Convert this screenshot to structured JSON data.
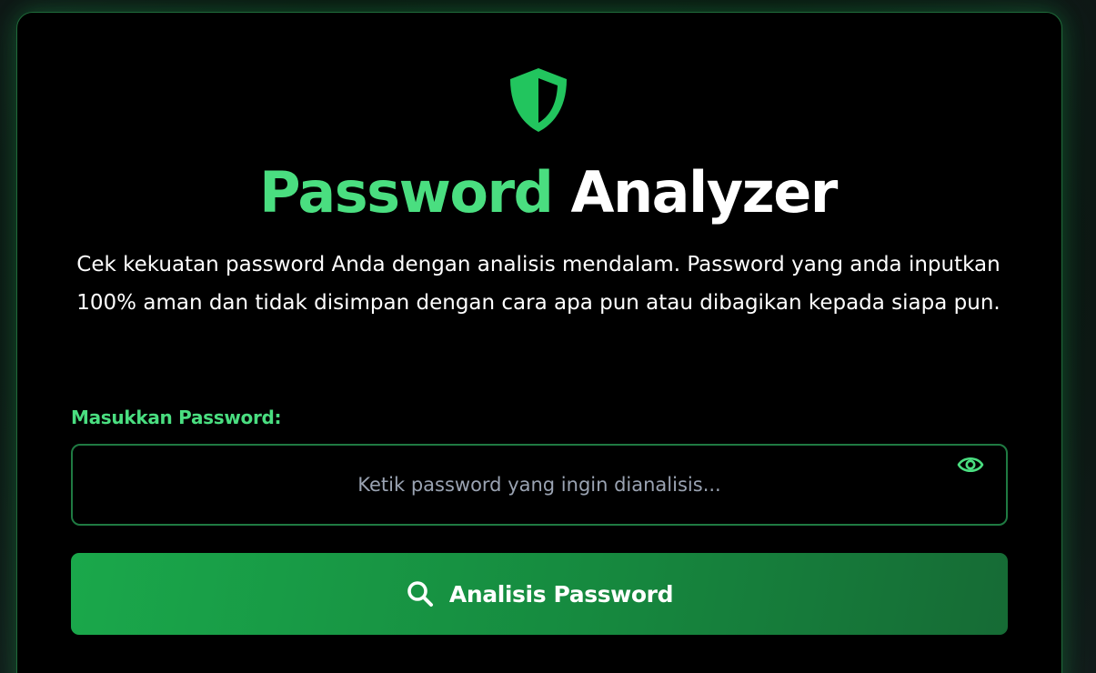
{
  "header": {
    "title_accent": "Password",
    "title_plain": "Analyzer",
    "description": "Cek kekuatan password Anda dengan analisis mendalam. Password yang anda inputkan 100% aman dan tidak disimpan dengan cara apa pun atau dibagikan kepada siapa pun.",
    "icon": "shield-icon"
  },
  "form": {
    "label": "Masukkan Password:",
    "input_value": "",
    "input_placeholder": "Ketik password yang ingin dianalisis...",
    "toggle_icon": "eye-icon",
    "submit_label": "Analisis Password",
    "submit_icon": "search-icon"
  },
  "colors": {
    "accent": "#4ade80",
    "shield": "#22c55e",
    "button_start": "#1aa84b",
    "button_end": "#166b35",
    "input_border": "#1f7a42",
    "background": "#000000"
  }
}
